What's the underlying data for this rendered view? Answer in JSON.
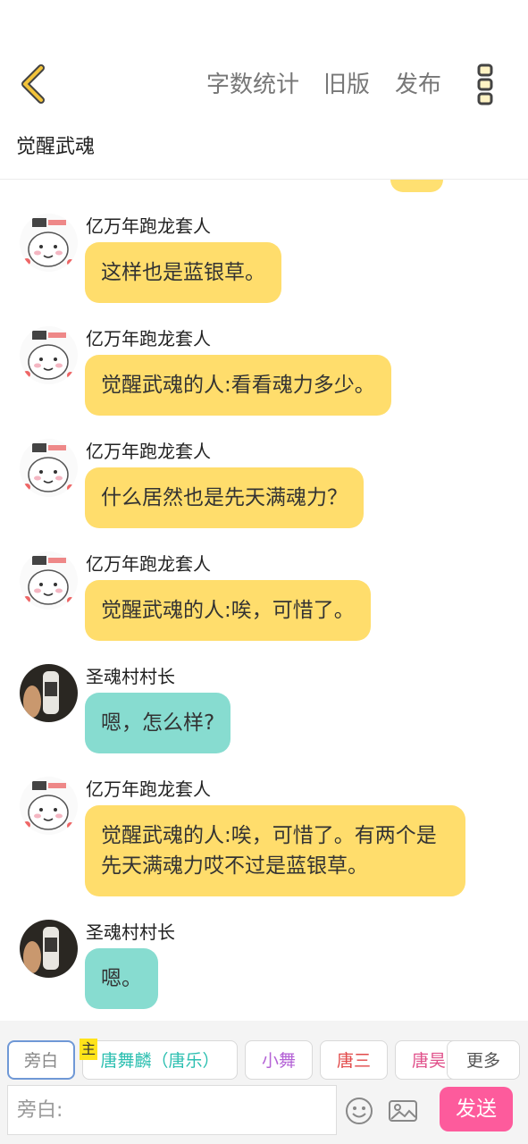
{
  "header": {
    "back_icon": "chevron-left-icon",
    "actions": [
      "字数统计",
      "旧版",
      "发布"
    ],
    "menu_icon": "vertical-dots-icon",
    "title": "觉醒武魂",
    "colors": {
      "accent": "#f2c33a"
    }
  },
  "messages": [
    {
      "sender": "亿万年跑龙套人",
      "avatar": "cartoon-avatar",
      "text": "这样也是蓝银草。",
      "bubble_color": "#ffdd6c"
    },
    {
      "sender": "亿万年跑龙套人",
      "avatar": "cartoon-avatar",
      "text": "觉醒武魂的人:看看魂力多少。",
      "bubble_color": "#ffdd6c"
    },
    {
      "sender": "亿万年跑龙套人",
      "avatar": "cartoon-avatar",
      "text": "什么居然也是先天满魂力？",
      "bubble_color": "#ffdd6c"
    },
    {
      "sender": "亿万年跑龙套人",
      "avatar": "cartoon-avatar",
      "text": "觉醒武魂的人:唉，可惜了。",
      "bubble_color": "#ffdd6c"
    },
    {
      "sender": "圣魂村村长",
      "avatar": "photo-avatar",
      "text": "嗯，怎么样?",
      "bubble_color": "#87dcd0"
    },
    {
      "sender": "亿万年跑龙套人",
      "avatar": "cartoon-avatar",
      "text": "觉醒武魂的人:唉，可惜了。有两个是先天满魂力哎不过是蓝银草。",
      "bubble_color": "#ffdd6c"
    },
    {
      "sender": "圣魂村村长",
      "avatar": "photo-avatar",
      "text": "嗯。",
      "bubble_color": "#87dcd0"
    }
  ],
  "roles": {
    "host_badge": "主",
    "items": [
      {
        "label": "旁白",
        "color": "#888888",
        "selected": true
      },
      {
        "label": "唐舞麟（唐乐）",
        "color": "#2bbfb0"
      },
      {
        "label": "小舞",
        "color": "#b463d6"
      },
      {
        "label": "唐三",
        "color": "#e24a4a"
      },
      {
        "label": "唐昊",
        "color": "#e0508a"
      }
    ],
    "more_label": "更多"
  },
  "composer": {
    "placeholder": "旁白:",
    "emoji_icon": "smiley-icon",
    "image_icon": "image-icon",
    "send_label": "发送",
    "send_color": "#fd5b9c"
  }
}
